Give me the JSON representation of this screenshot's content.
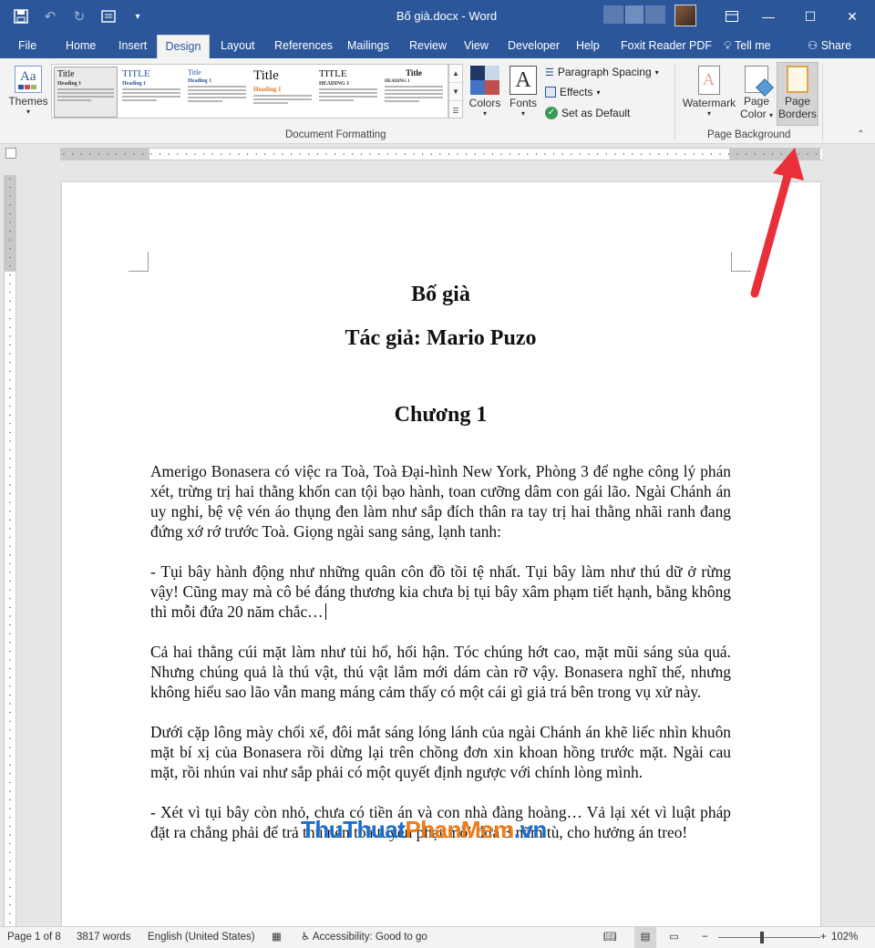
{
  "titlebar": {
    "title": "Bố già.docx  -  Word",
    "minimize": "—",
    "maximize": "☐",
    "close": "✕"
  },
  "tabs": [
    "File",
    "Home",
    "Insert",
    "Design",
    "Layout",
    "References",
    "Mailings",
    "Review",
    "View",
    "Developer",
    "Help",
    "Foxit Reader PDF",
    "Tell me",
    "Share"
  ],
  "active_tab": "Design",
  "ribbon": {
    "themes_label": "Themes",
    "gallery": [
      {
        "title": "Title",
        "heading": "Heading 1"
      },
      {
        "title": "TITLE",
        "heading": "Heading 1"
      },
      {
        "title": "Title",
        "heading": "Heading 1"
      },
      {
        "title": "Title",
        "heading": "Heading 1"
      },
      {
        "title": "TITLE",
        "heading": "HEADING 1"
      },
      {
        "title": "Title",
        "heading": "HEADING 1"
      }
    ],
    "colors_label": "Colors",
    "fonts_label": "Fonts",
    "paragraph_spacing": "Paragraph Spacing",
    "effects": "Effects",
    "set_default": "Set as Default",
    "group_document_formatting": "Document Formatting",
    "watermark": "Watermark",
    "page_color_1": "Page",
    "page_color_2": "Color",
    "page_borders_1": "Page",
    "page_borders_2": "Borders",
    "group_page_background": "Page Background"
  },
  "document": {
    "title": "Bố già",
    "author": "Tác giả: Mario Puzo",
    "chapter": "Chương 1",
    "paragraphs": [
      "Amerigo Bonasera có việc ra Toà, Toà Đại-hình New York, Phòng 3 để nghe công lý phán xét, trừng trị hai thằng khốn can tội bạo hành, toan cưỡng dâm con gái lão. Ngài Chánh án uy nghi, bệ vệ vén áo thụng đen làm như sắp đích thân ra tay trị hai thằng nhãi ranh đang đứng xớ rớ trước Toà. Giọng ngài sang sảng, lạnh tanh:",
      "- Tụi bây hành động như những quân côn đồ tồi tệ nhất. Tụi bây làm như thú dữ ở rừng vậy! Cũng may mà cô bé đáng thương kia chưa bị tụi bây xâm phạm tiết hạnh, bằng không thì mỗi đứa 20 năm chắc…",
      "Cả hai thằng cúi mặt làm như tủi hổ, hối hận. Tóc chúng hớt cao, mặt mũi sáng sủa quá. Nhưng chúng quả là thú vật, thú vật lắm mới dám càn rỡ vậy. Bonasera nghĩ thế, nhưng không hiểu sao lão vẫn mang máng cảm thấy có một cái gì giả trá bên trong vụ xử này.",
      "Dưới cặp lông mày chổi xể, đôi mắt sáng lóng lánh của ngài Chánh án khẽ liếc nhìn khuôn mặt bí xị của Bonasera rồi dừng lại trên chồng đơn xin khoan hồng trước mặt. Ngài cau mặt, rồi nhún vai như sắp phải có một quyết định ngược với chính lòng mình.",
      "- Xét vì tụi bây còn nhỏ, chưa có tiền án và con nhà đàng hoàng… Vả lại xét vì luật pháp đặt ra chẳng phải để trả thù nên toà tuyên phạt mỗi đứa 3 năm tù, cho hưởng án treo!"
    ]
  },
  "watermark": {
    "part1": "ThuThuat",
    "part2": "PhanMem",
    "part3": ".vn"
  },
  "statusbar": {
    "page": "Page 1 of 8",
    "words": "3817 words",
    "language": "English (United States)",
    "accessibility": "Accessibility: Good to go",
    "zoom": "102%"
  },
  "colors": {
    "brand": "#2b579a",
    "arrow": "#e8303a"
  }
}
